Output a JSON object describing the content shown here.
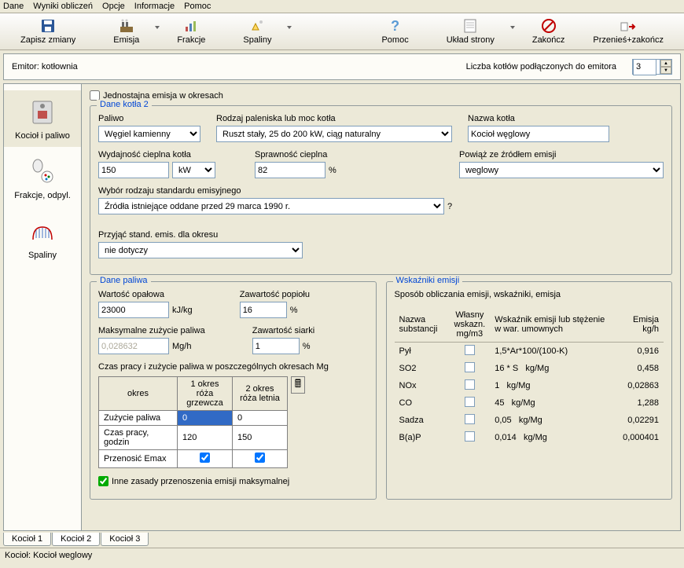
{
  "menu": {
    "dane": "Dane",
    "wyniki": "Wyniki obliczeń",
    "opcje": "Opcje",
    "informacje": "Informacje",
    "pomoc": "Pomoc"
  },
  "toolbar": {
    "save": "Zapisz zmiany",
    "emisja": "Emisja",
    "frakcje": "Frakcje",
    "spaliny": "Spaliny",
    "pomoc": "Pomoc",
    "uklad": "Układ strony",
    "zakoncz": "Zakończ",
    "przenies": "Przenieś+zakończ"
  },
  "emitter": {
    "label": "Emitor: kotłownia",
    "count_label": "Liczba kotłów podłączonych do emitora",
    "count": "3"
  },
  "sidebar": {
    "kociol": "Kocioł i  paliwo",
    "frakcje": "Frakcje, odpyl.",
    "spaliny": "Spaliny"
  },
  "jednostajna": "Jednostajna emisja w okresach",
  "kotla": {
    "title": "Dane kotła 2",
    "paliwo_label": "Paliwo",
    "paliwo": "Węgiel kamienny",
    "rodzaj_label": "Rodzaj paleniska lub moc kotła",
    "rodzaj": "Ruszt stały, 25 do 200 kW, ciąg naturalny",
    "nazwa_label": "Nazwa kotła",
    "nazwa": "Kocioł węglowy",
    "wydajnosc_label": "Wydajność cieplna  kotła",
    "wydajnosc": "150",
    "wyd_unit": "kW",
    "sprawnosc_label": "Sprawność cieplna",
    "sprawnosc": "82",
    "spr_unit": "%",
    "powiaz_label": "Powiąż ze źródłem emisji",
    "powiaz": "weglowy",
    "wybor_label": "Wybór rodzaju standardu emisyjnego",
    "wybor": "Źródła istniejące oddane przed 29 marca 1990 r.",
    "wybor_q": "?",
    "przyjac_label": "Przyjąć stand. emis. dla okresu",
    "przyjac": "nie dotyczy"
  },
  "paliwa": {
    "title": "Dane paliwa",
    "wartosc_label": "Wartość opałowa",
    "wartosc": "23000",
    "wartosc_unit": "kJ/kg",
    "popiol_label": "Zawartość popiołu",
    "popiol": "16",
    "popiol_unit": "%",
    "max_label": "Maksymalne zużycie paliwa",
    "max": "0,028632",
    "max_unit": "Mg/h",
    "siarka_label": "Zawartość siarki",
    "siarka": "1",
    "siarka_unit": "%",
    "czas_label": "Czas pracy i zużycie paliwa w poszczególnych okresach Mg",
    "th_okres": "okres",
    "th_o1": "1 okres róża grzewcza",
    "th_o2": "2 okres róża letnia",
    "r1": "Zużycie paliwa",
    "r1v1": "0",
    "r1v2": "0",
    "r2": "Czas pracy, godzin",
    "r2v1": "120",
    "r2v2": "150",
    "r3": "Przenosić Emax",
    "inne": "Inne zasady przenoszenia emisji maksymalnej"
  },
  "wskazniki": {
    "title": "Wskaźniki emisji",
    "sposob": "Sposób obliczania emisji, wskaźniki, emisja",
    "th_nazwa": "Nazwa substancji",
    "th_wlasny": "Własny wskazn. mg/m3",
    "th_wskaznik": "Wskaźnik emisji lub stężenie w war. umownych",
    "th_emisja": "Emisja kg/h",
    "rows": [
      {
        "n": "Pył",
        "w": "1,5*Ar*100/(100-K)",
        "u": "",
        "e": "0,916"
      },
      {
        "n": "SO2",
        "w": "16 * S",
        "u": "kg/Mg",
        "e": "0,458"
      },
      {
        "n": "NOx",
        "w": "1",
        "u": "kg/Mg",
        "e": "0,02863"
      },
      {
        "n": "CO",
        "w": "45",
        "u": "kg/Mg",
        "e": "1,288"
      },
      {
        "n": "Sadza",
        "w": "0,05",
        "u": "kg/Mg",
        "e": "0,02291"
      },
      {
        "n": "B(a)P",
        "w": "0,014",
        "u": "kg/Mg",
        "e": "0,000401"
      }
    ]
  },
  "tabs": {
    "t1": "Kocioł 1",
    "t2": "Kocioł 2",
    "t3": "Kocioł 3"
  },
  "status": "Kocioł: Kocioł weglowy"
}
